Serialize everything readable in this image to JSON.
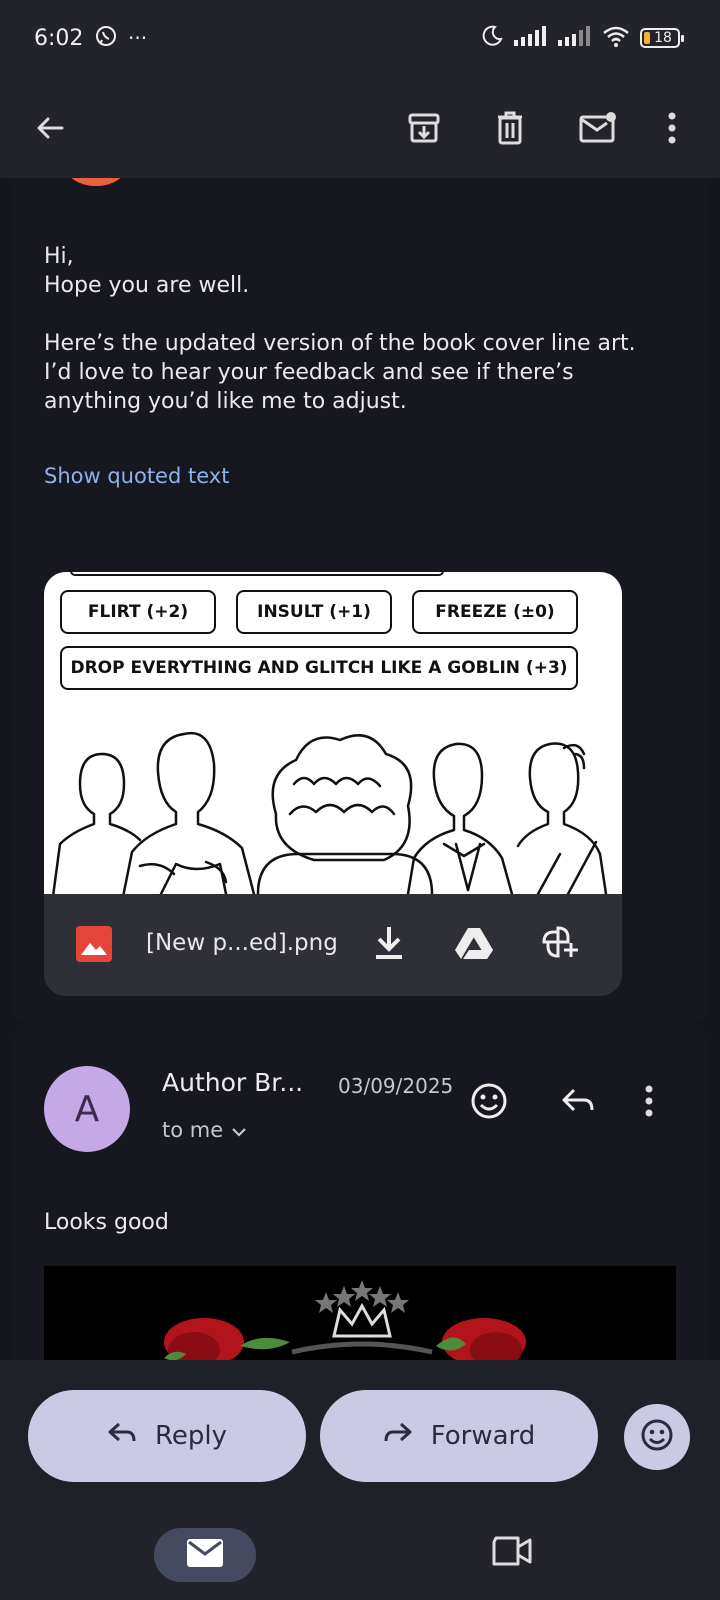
{
  "status": {
    "time": "6:02",
    "battery": "18"
  },
  "message1": {
    "greeting": "Hi,",
    "line2": "Hope you are well.",
    "paragraph": "Here’s the updated version of the book cover line art. I’d love to hear your feedback and see if there’s anything you’d like me to adjust.",
    "quoted_link": "Show quoted text",
    "attachment": {
      "filename": "[New p...ed].png",
      "pills": [
        "FLIRT (+2)",
        "INSULT (+1)",
        "FREEZE (±0)",
        "DROP EVERYTHING AND GLITCH LIKE A GOBLIN (+3)"
      ]
    }
  },
  "message2": {
    "avatar_letter": "A",
    "sender": "Author Br...",
    "date": "03/09/2025",
    "recipient": "to me",
    "body": "Looks good"
  },
  "actions": {
    "reply": "Reply",
    "forward": "Forward"
  }
}
